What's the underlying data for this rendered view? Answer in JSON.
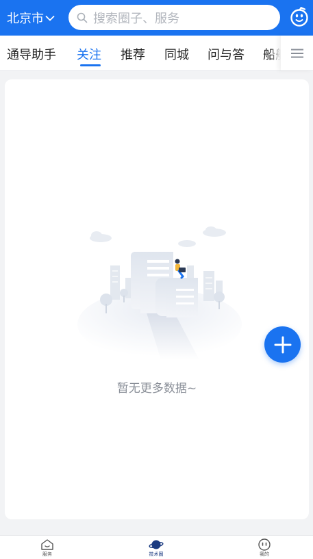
{
  "header": {
    "city": "北京市",
    "search_placeholder": "搜索圈子、服务"
  },
  "tabs": [
    {
      "label": "通导助手",
      "active": false
    },
    {
      "label": "关注",
      "active": true
    },
    {
      "label": "推荐",
      "active": false
    },
    {
      "label": "同城",
      "active": false
    },
    {
      "label": "问与答",
      "active": false
    },
    {
      "label": "船舶",
      "active": false
    }
  ],
  "content": {
    "empty_text": "暂无更多数据~"
  },
  "bottom_nav": [
    {
      "label": "服务",
      "icon": "home-icon",
      "active": false
    },
    {
      "label": "技术圈",
      "icon": "planet-icon",
      "active": true
    },
    {
      "label": "我的",
      "icon": "face-icon",
      "active": false
    }
  ],
  "colors": {
    "primary": "#1a73f0",
    "background": "#f2f3f5",
    "empty_text": "#8a8f98"
  }
}
